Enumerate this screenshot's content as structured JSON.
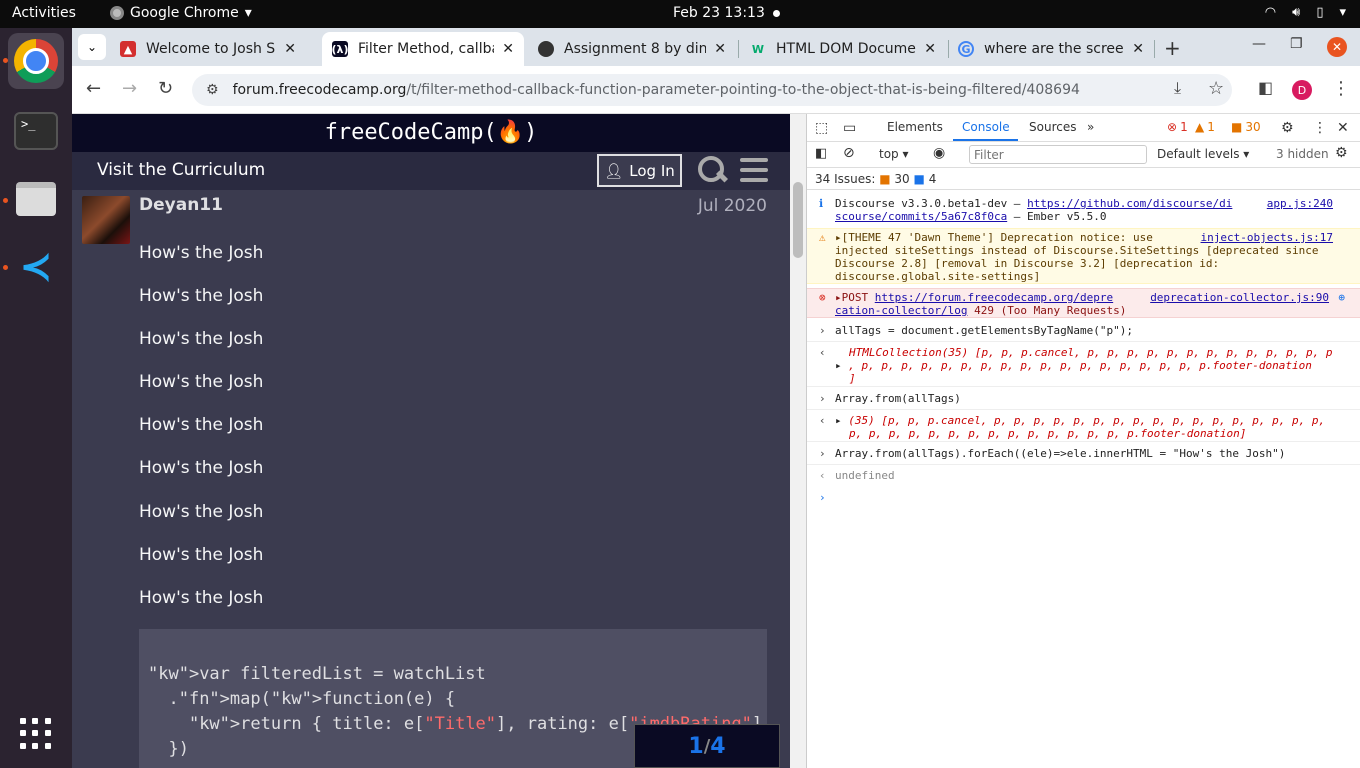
{
  "topbar": {
    "activities": "Activities",
    "app_name": "Google Chrome",
    "datetime": "Feb 23  13:13"
  },
  "tabs": [
    {
      "title": "Welcome to Josh So",
      "favicon_color": "#d32f2f"
    },
    {
      "title": "Filter Method, callba",
      "favicon_color": "#0a0a23"
    },
    {
      "title": "Assignment 8 by din",
      "favicon_color": "#222222"
    },
    {
      "title": "HTML DOM Docume",
      "favicon_color": "#04aa6d"
    },
    {
      "title": "where are the screen",
      "favicon_color": "#4285f4"
    }
  ],
  "omnibox": {
    "host": "forum.freecodecamp.org",
    "path": "/t/filter-method-callback-function-parameter-pointing-to-the-object-that-is-being-filtered/408694"
  },
  "profile_initial": "D",
  "forum": {
    "logo": "freeCodeCamp(🔥)",
    "visit": "Visit the Curriculum",
    "login": "Log In",
    "user": "Deyan11",
    "date": "Jul 2020",
    "paragraphs": [
      "How's the Josh",
      "How's the Josh",
      "How's the Josh",
      "How's the Josh",
      "How's the Josh",
      "How's the Josh",
      "How's the Josh",
      "How's the Josh",
      "How's the Josh"
    ],
    "code_lines": [
      "var filteredList = watchList",
      "  .map(function(e) {",
      "    return { title: e[\"Title\"], rating: e[\"imdbRating\"] }",
      "  })"
    ],
    "pager_current": "1",
    "pager_total": "4"
  },
  "devtools": {
    "tabs": [
      "Elements",
      "Console",
      "Sources"
    ],
    "errors": "1",
    "warnings": "1",
    "issues_badge": "30",
    "context": "top",
    "filter_placeholder": "Filter",
    "levels": "Default levels",
    "hidden": "3 hidden",
    "issues_label": "34 Issues:",
    "issues_warn": "30",
    "issues_info": "4",
    "messages": {
      "info_text_a": "Discourse v3.3.0.beta1-dev — ",
      "info_link": "https://github.com/discourse/di",
      "info_link2": "scourse/commits/5a67c8f0ca",
      "info_text_b": " — Ember v5.5.0",
      "info_src": "app.js:240",
      "warn_text_1": "[THEME 47 'Dawn Theme'] Deprecation notice: use",
      "warn_text_2": "injected siteSettings instead of Discourse.SiteSettings [deprecated since",
      "warn_text_3": "Discourse 2.8] [removal in Discourse 3.2] [deprecation id:",
      "warn_text_4": "discourse.global.site-settings]",
      "warn_src": "inject-objects.js:17",
      "err_method": "POST ",
      "err_link": "https://forum.freecodecamp.org/depre",
      "err_link2": "cation-collector/log",
      "err_status": " 429 (Too Many Requests)",
      "err_src": "deprecation-collector.js:90",
      "cmd1": "allTags = document.getElementsByTagName(\"p\");",
      "out1_line1": "HTMLCollection(35) [p, p, p.cancel, p, p, p, p, p, p, p, p, p, p, p, p, p",
      "out1_line2": ", p, p, p, p, p, p, p, p, p, p, p, p, p, p, p, p, p, p.footer-donation",
      "out1_line3": "]",
      "cmd2": "Array.from(allTags)",
      "out2_line1": "(35) [p, p, p.cancel, p, p, p, p, p, p, p, p, p, p, p, p, p, p, p, p, p,",
      "out2_line2": "p, p, p, p, p, p, p, p, p, p, p, p, p, p, p.footer-donation]",
      "cmd3": "Array.from(allTags).forEach((ele)=>ele.innerHTML = \"How's the Josh\")",
      "out3": "undefined"
    }
  }
}
